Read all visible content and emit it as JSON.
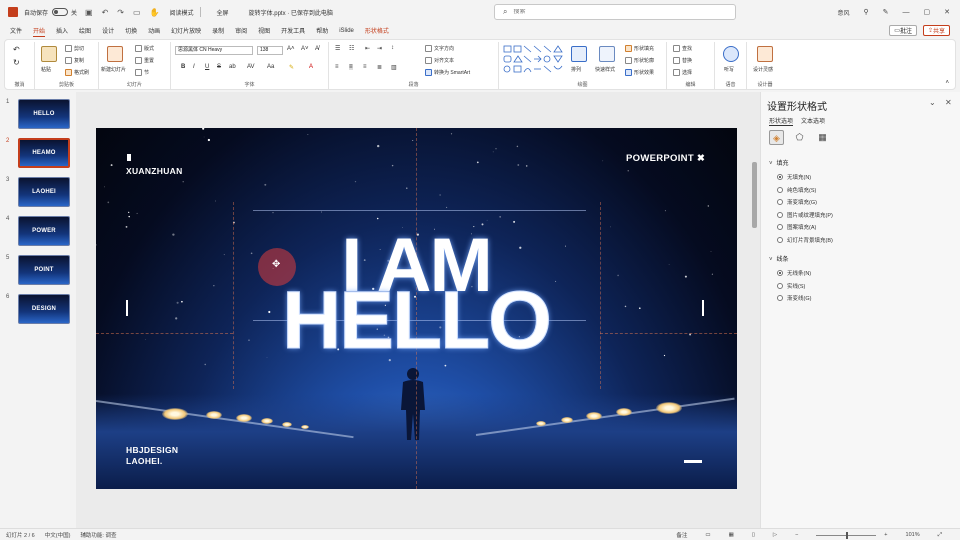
{
  "titlebar": {
    "autosave_label": "自动保存",
    "toggle_state": "关",
    "quick_access_icons": [
      "save-icon",
      "undo-icon",
      "redo-icon",
      "present-icon",
      "touch-icon"
    ],
    "mode_label": "阅读模式",
    "mode2_label": "全屏",
    "filename": "旋转字体.pptx · 已保存到此电脑",
    "search_placeholder": "搜索",
    "user": "意风",
    "right_icons": [
      "mic-icon",
      "pen-icon",
      "minimize-icon",
      "maximize-icon",
      "close-icon"
    ]
  },
  "tabs": [
    {
      "label": "文件"
    },
    {
      "label": "开始",
      "active": true
    },
    {
      "label": "插入"
    },
    {
      "label": "绘图"
    },
    {
      "label": "设计"
    },
    {
      "label": "切换"
    },
    {
      "label": "动画"
    },
    {
      "label": "幻灯片放映"
    },
    {
      "label": "录制"
    },
    {
      "label": "审阅"
    },
    {
      "label": "视图"
    },
    {
      "label": "开发工具"
    },
    {
      "label": "帮助"
    },
    {
      "label": "iSlide"
    },
    {
      "label": "形状格式",
      "contextual": true
    }
  ],
  "ribbon_buttons": {
    "comment": "批注",
    "share": "共享"
  },
  "ribbon": {
    "groups": [
      "撤消",
      "剪贴板",
      "幻灯片",
      "字体",
      "段落",
      "绘图",
      "编辑",
      "语音",
      "设计器"
    ],
    "clipboard": {
      "paste": "粘贴",
      "cut": "剪切",
      "copy": "复制",
      "format": "格式刷"
    },
    "slides": {
      "new": "新建幻灯片",
      "layout": "版式",
      "reset": "重置",
      "section": "节"
    },
    "font": {
      "name": "思源黑体 CN Heavy",
      "size": "138",
      "buttons": [
        "B",
        "I",
        "U",
        "S",
        "ab",
        "AV",
        "Aa"
      ]
    },
    "paragraph": {
      "text_direction": "文字方向",
      "align_text": "对齐文本",
      "smartart": "转换为 SmartArt"
    },
    "drawing": {
      "arrange": "排列",
      "quick_styles": "快速样式",
      "fill": "形状填充",
      "outline": "形状轮廓",
      "effects": "形状效果"
    },
    "editing": {
      "find": "查找",
      "replace": "替换",
      "select": "选择"
    },
    "voice": {
      "dictate": "听写"
    },
    "designer": {
      "ideas": "设计灵感"
    }
  },
  "thumbnails": [
    {
      "num": "1",
      "label": "HELLO"
    },
    {
      "num": "2",
      "label": "HEAMO",
      "selected": true
    },
    {
      "num": "3",
      "label": "LAOHEI"
    },
    {
      "num": "4",
      "label": "POWER"
    },
    {
      "num": "5",
      "label": "POINT"
    },
    {
      "num": "6",
      "label": "DESIGN"
    }
  ],
  "slide": {
    "top_left": "XUANZHUAN",
    "top_right": "POWERPOINT ✖",
    "big_line1": "I AM",
    "big_line2": "HELLO",
    "bottom_left_1": "HBJDESIGN",
    "bottom_left_2": "LAOHEI."
  },
  "pane": {
    "title": "设置形状格式",
    "tabs": [
      {
        "label": "形状选项",
        "active": true
      },
      {
        "label": "文本选项"
      }
    ],
    "icons": [
      "fill-line-icon",
      "effects-icon",
      "size-properties-icon"
    ],
    "fill_section": "填充",
    "fill_options": [
      {
        "label": "无填充(N)",
        "on": true
      },
      {
        "label": "纯色填充(S)"
      },
      {
        "label": "渐变填充(G)"
      },
      {
        "label": "图片或纹理填充(P)"
      },
      {
        "label": "图案填充(A)"
      },
      {
        "label": "幻灯片背景填充(B)"
      }
    ],
    "line_section": "线条",
    "line_options": [
      {
        "label": "无线条(N)",
        "on": true
      },
      {
        "label": "实线(S)"
      },
      {
        "label": "渐变线(G)"
      }
    ]
  },
  "status": {
    "slide_info": "幻灯片 2 / 6",
    "lang": "中文(中国)",
    "accessibility": "辅助功能: 调查",
    "notes": "备注",
    "zoom": "101%"
  },
  "colors": {
    "accent": "#c43e1c",
    "slide_dark": "#050b20",
    "slide_blue": "#1f4fa8"
  }
}
